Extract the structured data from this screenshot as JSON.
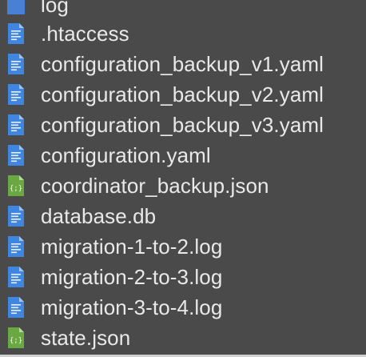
{
  "file_list": {
    "items": [
      {
        "name": "log",
        "icon": "folder-icon",
        "color": "#3a6fc9"
      },
      {
        "name": ".htaccess",
        "icon": "text-file-icon",
        "color": "#3f86e0"
      },
      {
        "name": "configuration_backup_v1.yaml",
        "icon": "text-file-icon",
        "color": "#3f86e0"
      },
      {
        "name": "configuration_backup_v2.yaml",
        "icon": "text-file-icon",
        "color": "#3f86e0"
      },
      {
        "name": "configuration_backup_v3.yaml",
        "icon": "text-file-icon",
        "color": "#3f86e0"
      },
      {
        "name": "configuration.yaml",
        "icon": "text-file-icon",
        "color": "#3f86e0"
      },
      {
        "name": "coordinator_backup.json",
        "icon": "json-file-icon",
        "color": "#6aa844"
      },
      {
        "name": "database.db",
        "icon": "text-file-icon",
        "color": "#3f86e0"
      },
      {
        "name": "migration-1-to-2.log",
        "icon": "text-file-icon",
        "color": "#3f86e0"
      },
      {
        "name": "migration-2-to-3.log",
        "icon": "text-file-icon",
        "color": "#3f86e0"
      },
      {
        "name": "migration-3-to-4.log",
        "icon": "text-file-icon",
        "color": "#3f86e0"
      },
      {
        "name": "state.json",
        "icon": "json-file-icon",
        "color": "#6aa844"
      }
    ]
  }
}
